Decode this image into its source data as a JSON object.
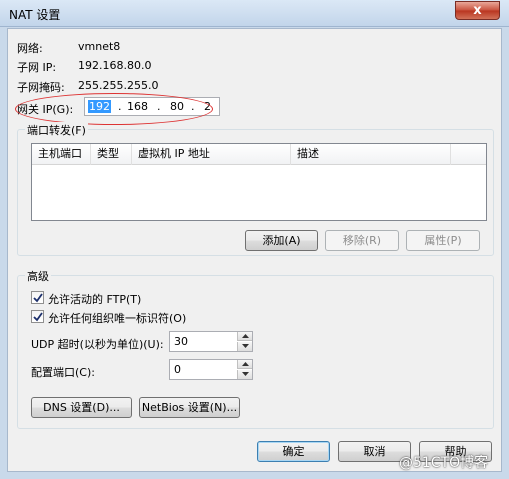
{
  "window": {
    "title": "NAT 设置",
    "close_glyph": "x"
  },
  "network": {
    "name_label": "网络:",
    "name_value": "vmnet8",
    "subnet_ip_label": "子网 IP:",
    "subnet_ip_value": "192.168.80.0",
    "subnet_mask_label": "子网掩码:",
    "subnet_mask_value": "255.255.255.0",
    "gateway_label": "网关 IP(G):",
    "gateway_octets": [
      "192",
      "168",
      "80",
      "2"
    ],
    "gateway_dot": "."
  },
  "port_forwarding": {
    "title": "端口转发(F)",
    "columns": [
      "主机端口",
      "类型",
      "虚拟机 IP 地址",
      "描述"
    ],
    "rows": [],
    "add_label": "添加(A)",
    "remove_label": "移除(R)",
    "properties_label": "属性(P)"
  },
  "advanced": {
    "title": "高级",
    "allow_active_ftp": {
      "label": "允许活动的 FTP(T)",
      "checked": true
    },
    "allow_any_oui": {
      "label": "允许任何组织唯一标识符(O)",
      "checked": true
    },
    "udp_timeout_label": "UDP 超时(以秒为单位)(U):",
    "udp_timeout_value": "30",
    "config_port_label": "配置端口(C):",
    "config_port_value": "0",
    "dns_button": "DNS 设置(D)...",
    "netbios_button": "NetBios 设置(N)..."
  },
  "footer": {
    "ok": "确定",
    "cancel": "取消",
    "help": "帮助"
  },
  "watermark": "@51CTO博客",
  "colors": {
    "selection": "#3399ff",
    "annotation_oval": "#dd3333",
    "close_button": "#c8503c"
  }
}
